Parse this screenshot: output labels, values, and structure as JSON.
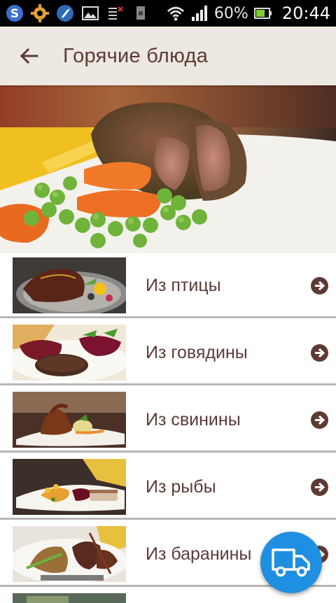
{
  "status_bar": {
    "battery_percent": "60%",
    "time": "20:44",
    "left_icons": [
      "s-app-icon",
      "settings-gear-icon",
      "rocket-icon",
      "gallery-icon",
      "alarm-list-icon",
      "sim-icon"
    ],
    "right_icons": [
      "wifi-icon",
      "signal-icon",
      "battery-icon"
    ]
  },
  "app_bar": {
    "title": "Горячие блюда",
    "back_icon": "arrow-left-icon"
  },
  "hero": {
    "image": "roast-meat-with-peas-and-carrots"
  },
  "categories": [
    {
      "label": "Из птицы",
      "image": "duck-dish"
    },
    {
      "label": "Из говядины",
      "image": "beef-steak-dish"
    },
    {
      "label": "Из свинины",
      "image": "pork-ribs-dish"
    },
    {
      "label": "Из рыбы",
      "image": "fish-dish"
    },
    {
      "label": "Из баранины",
      "image": "lamb-dish"
    }
  ],
  "fab": {
    "icon": "delivery-truck-icon"
  },
  "colors": {
    "appbar_bg": "#ece8e2",
    "title_text": "#5e3a34",
    "list_text": "#5b3b37",
    "chevron": "#5e3a34",
    "divider": "#b7b7b7",
    "fab": "#1f8fe1"
  }
}
